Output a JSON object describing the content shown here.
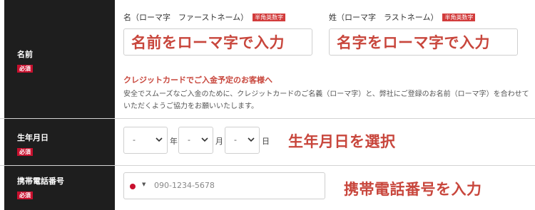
{
  "name_row": {
    "label": "名前",
    "required": "必須",
    "first_name": {
      "label": "名（ローマ字　ファーストネーム）",
      "badge": "半角英数字",
      "value": "名前をローマ字で入力"
    },
    "last_name": {
      "label": "姓（ローマ字　ラストネーム）",
      "badge": "半角英数字",
      "value": "名字をローマ字で入力"
    },
    "notice_title": "クレジットカードでご入金予定のお客様へ",
    "notice_body": "安全でスムーズなご入金のために、クレジットカードのご名義（ローマ字）と、弊社にご登録のお名前（ローマ字）を合わせていただくようご協力をお願いいたします。"
  },
  "birth_row": {
    "label": "生年月日",
    "required": "必須",
    "year": {
      "value": "-",
      "unit": "年"
    },
    "month": {
      "value": "-",
      "unit": "月"
    },
    "day": {
      "value": "-",
      "unit": "日"
    },
    "annotation": "生年月日を選択"
  },
  "phone_row": {
    "label": "携帯電話番号",
    "required": "必須",
    "country_flag_icon": "japan-flag-icon",
    "placeholder": "090-1234-5678",
    "annotation": "携帯電話番号を入力"
  },
  "colors": {
    "label_bg": "#1e1e1e",
    "required_badge": "#c8102e",
    "accent_red": "#c8463c",
    "border": "#cfcfcf"
  }
}
